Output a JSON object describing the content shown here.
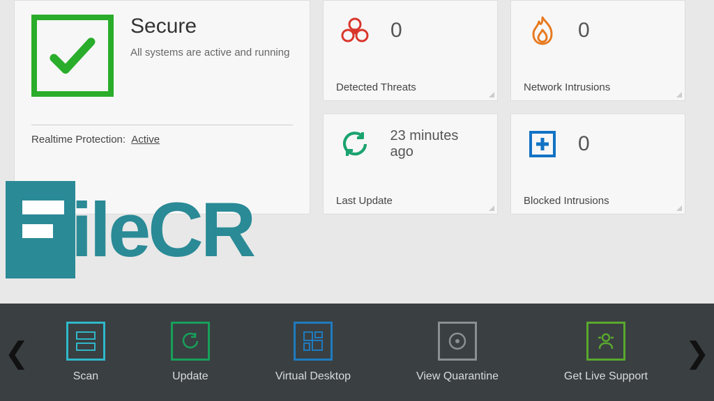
{
  "status": {
    "title": "Secure",
    "subtitle": "All systems are active and running",
    "realtime_label": "Realtime Protection:",
    "realtime_value": "Active"
  },
  "tiles": {
    "threats": {
      "value": "0",
      "label": "Detected Threats"
    },
    "network": {
      "value": "0",
      "label": "Network Intrusions"
    },
    "update": {
      "value": "23 minutes ago",
      "label": "Last Update"
    },
    "blocked": {
      "value": "0",
      "label": "Blocked Intrusions"
    }
  },
  "toolbar": {
    "scan": "Scan",
    "update": "Update",
    "virtual": "Virtual Desktop",
    "quarantine": "View Quarantine",
    "support": "Get Live Support"
  },
  "watermark": "ileCR",
  "colors": {
    "success": "#2aad2a",
    "threat": "#d9362b",
    "flame": "#e77a1f",
    "refresh": "#1aa36f",
    "blocked": "#1273c4",
    "toolbar_bg": "#3a3f42",
    "brand": "#2a8a96"
  }
}
